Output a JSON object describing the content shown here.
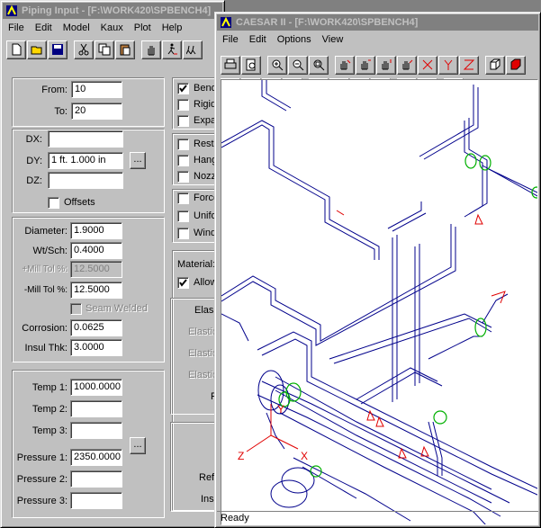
{
  "piping_window": {
    "title": "Piping Input - [F:\\WORK420\\SPBENCH4]",
    "menus": [
      "File",
      "Edit",
      "Model",
      "Kaux",
      "Plot",
      "Help"
    ],
    "nodes": {
      "from_label": "From:",
      "from_value": "10",
      "to_label": "To:",
      "to_value": "20"
    },
    "deltas": {
      "dx_label": "DX:",
      "dx_value": "",
      "dy_label": "DY:",
      "dy_value": "1 ft.  1.000 in",
      "dz_label": "DZ:",
      "dz_value": "",
      "offsets_label": "Offsets",
      "dots": "..."
    },
    "pipe": {
      "diameter_label": "Diameter:",
      "diameter_value": "1.9000",
      "wtsch_label": "Wt/Sch:",
      "wtsch_value": "0.4000",
      "plus_mill_label": "+Mill Tol %:",
      "plus_mill_value": "12.5000",
      "minus_mill_label": "-Mill Tol %:",
      "minus_mill_value": "12.5000",
      "seam_label": "Seam Welded",
      "corrosion_label": "Corrosion:",
      "corrosion_value": "0.0625",
      "insul_label": "Insul Thk:",
      "insul_value": "3.0000"
    },
    "operating": {
      "temp1_label": "Temp 1:",
      "temp1_value": "1000.0000",
      "temp2_label": "Temp 2:",
      "temp2_value": "",
      "temp3_label": "Temp 3:",
      "temp3_value": "",
      "pres1_label": "Pressure 1:",
      "pres1_value": "2350.0000",
      "pres2_label": "Pressure 2:",
      "pres2_value": "",
      "pres3_label": "Pressure 3:",
      "pres3_value": "",
      "dots": "..."
    },
    "checks1": [
      "Bend",
      "Rigid",
      "Expa"
    ],
    "checks2": [
      "Rest",
      "Hang",
      "Nozz"
    ],
    "checks3": [
      "Force",
      "Unifo",
      "Wind"
    ],
    "material_label": "Material:",
    "allow_label": "Allow",
    "elastic": [
      "Elas",
      "Elastic",
      "Elastic",
      "Elastic",
      "P"
    ],
    "lower": [
      "Refi",
      "Insi"
    ]
  },
  "caesar_window": {
    "title": "CAESAR II - [F:\\WORK420\\SPBENCH4]",
    "menus": [
      "File",
      "Edit",
      "Options",
      "View"
    ],
    "status": "Ready",
    "axis": {
      "x": "X",
      "y": "Y",
      "z": "Z"
    }
  },
  "colors": {
    "pipe": "#00008b",
    "title_inactive": "#808080",
    "axis": "#e00000",
    "restraint": "#00b000"
  }
}
